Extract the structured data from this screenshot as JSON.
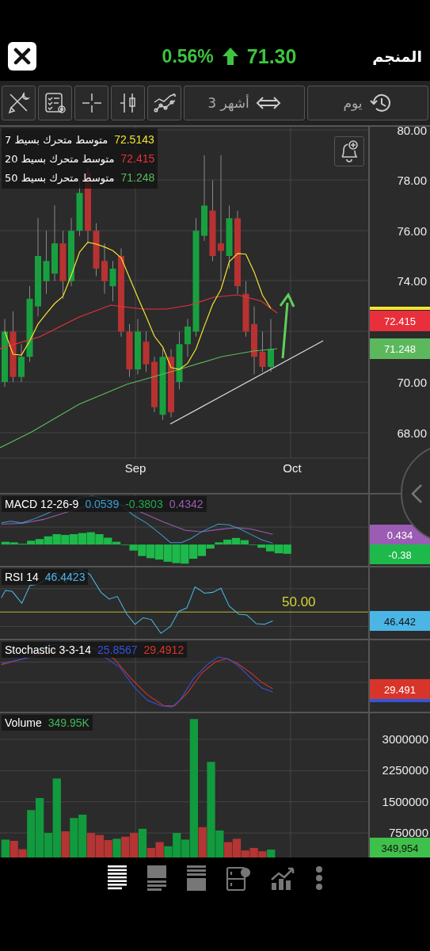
{
  "header": {
    "title": "المنجم",
    "price": "71.30",
    "change_percent": "0.56%"
  },
  "toolbar": {
    "range": "3 أشهر",
    "interval": "يوم"
  },
  "price_chart": {
    "legend": [
      {
        "label": "متوسط متحرك بسيط 7",
        "value": "72.5143",
        "color": "#f2e530"
      },
      {
        "label": "متوسط متحرك بسيط 20",
        "value": "72.415",
        "color": "#e8303c"
      },
      {
        "label": "متوسط متحرك بسيط 50",
        "value": "71.248",
        "color": "#5cb85c"
      }
    ],
    "y_labels": [
      "80.00",
      "78.00",
      "76.00",
      "74.00",
      "70.00",
      "68.00"
    ],
    "x_labels": [
      "Sep",
      "Oct"
    ],
    "badges": [
      {
        "value": "72.415",
        "color": "#e8303c"
      },
      {
        "value": "71.248",
        "color": "#5cb85c"
      }
    ]
  },
  "macd": {
    "title": "MACD 12-26-9",
    "values": [
      {
        "value": "0.0539",
        "color": "#3a9bd0"
      },
      {
        "value": "-0.3803",
        "color": "#22a84a"
      },
      {
        "value": "0.4342",
        "color": "#9b5cb4"
      }
    ],
    "badges": [
      {
        "value": "0.434",
        "color": "#9b5cb4"
      },
      {
        "value": "-0.38",
        "color": "#1db94a"
      }
    ]
  },
  "rsi": {
    "title": "RSI 14",
    "values": [
      {
        "value": "46.4423",
        "color": "#4bb6e6"
      }
    ],
    "level_label": "50.00",
    "badges": [
      {
        "value": "46.442",
        "color": "#4bb6e6"
      }
    ]
  },
  "stochastic": {
    "title": "Stochastic 3-3-14",
    "values": [
      {
        "value": "25.8567",
        "color": "#3355dd"
      },
      {
        "value": "29.4912",
        "color": "#d8352a"
      }
    ],
    "badges": [
      {
        "value": "29.491",
        "color": "#d8352a"
      }
    ]
  },
  "volume": {
    "title": "Volume",
    "value": "349.95K",
    "badge": "349,954",
    "y_labels": [
      "3000000",
      "2250000",
      "1500000",
      "750000"
    ]
  },
  "bottom_nav": [
    {
      "selected": true
    },
    {
      "selected": false
    },
    {
      "selected": false
    },
    {
      "selected": false
    },
    {
      "selected": false
    },
    {
      "selected": false
    }
  ]
}
